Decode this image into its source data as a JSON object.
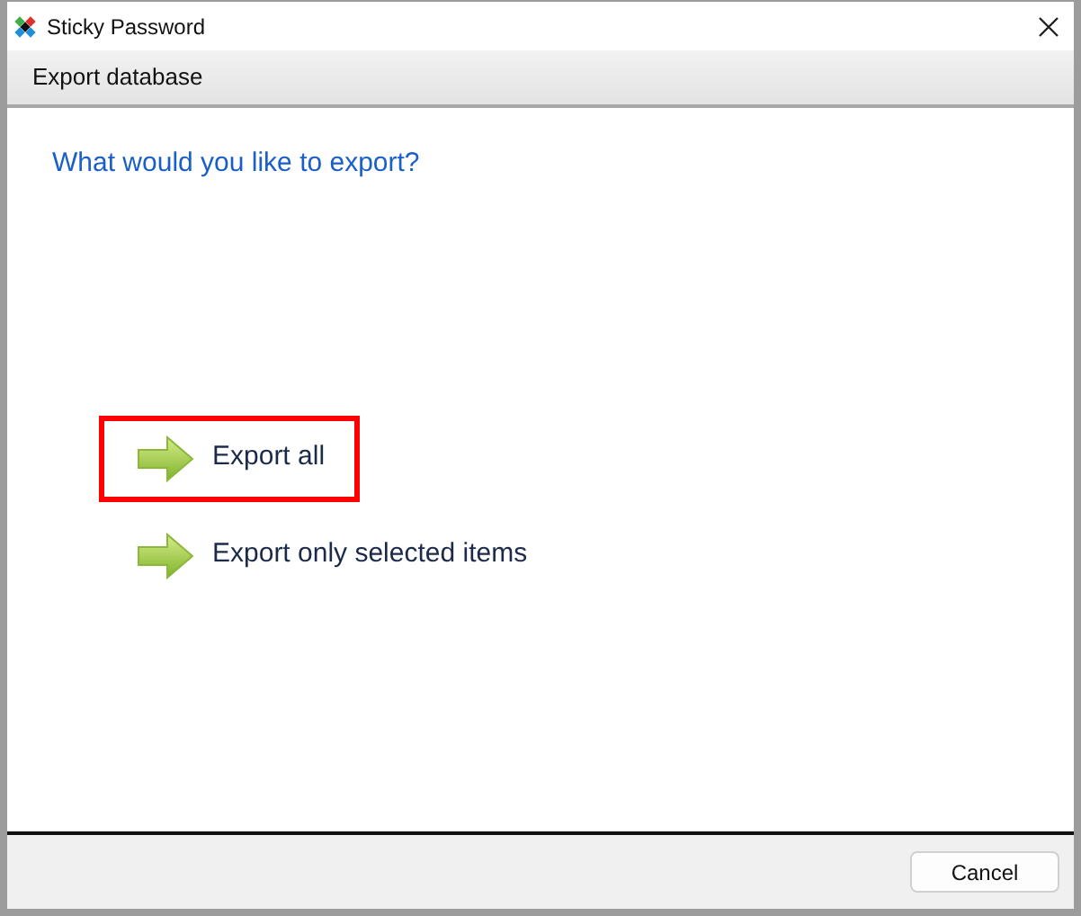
{
  "window": {
    "title": "Sticky Password"
  },
  "header": {
    "title": "Export database"
  },
  "question": "What would you like to export?",
  "options": [
    {
      "label": "Export all",
      "highlighted": true
    },
    {
      "label": "Export only selected items",
      "highlighted": false
    }
  ],
  "buttons": [
    {
      "label": "Cancel"
    }
  ]
}
